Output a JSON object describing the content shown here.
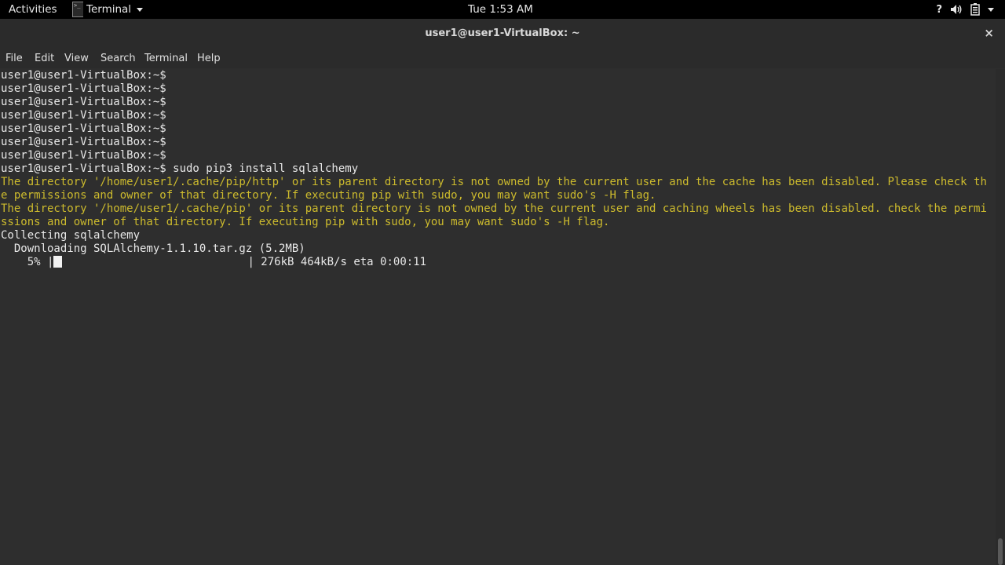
{
  "topbar": {
    "activities": "Activities",
    "app_name": "Terminal",
    "clock": "Tue  1:53 AM",
    "help_glyph": "?",
    "status_icons": [
      "help-icon",
      "speaker-icon",
      "battery-icon",
      "chevron-down-icon"
    ]
  },
  "window": {
    "title": "user1@user1-VirtualBox: ~",
    "close_glyph": "×"
  },
  "menu": [
    "File",
    "Edit",
    "View",
    "Search",
    "Terminal",
    "Help"
  ],
  "terminal": {
    "lines": [
      "user1@user1-VirtualBox:~$",
      "user1@user1-VirtualBox:~$",
      "user1@user1-VirtualBox:~$",
      "user1@user1-VirtualBox:~$",
      "user1@user1-VirtualBox:~$",
      "user1@user1-VirtualBox:~$",
      "user1@user1-VirtualBox:~$",
      "user1@user1-VirtualBox:~$ sudo pip3 install sqlalchemy",
      "The directory '/home/user1/.cache/pip/http' or its parent directory is not owned by the current user and the cache has been disabled. Please check th",
      "e permissions and owner of that directory. If executing pip with sudo, you may want sudo's -H flag.",
      "The directory '/home/user1/.cache/pip' or its parent directory is not owned by the current user and caching wheels has been disabled. check the permi",
      "ssions and owner of that directory. If executing pip with sudo, you may want sudo's -H flag.",
      "Collecting sqlalchemy",
      "  Downloading SQLAlchemy-1.1.10.tar.gz (5.2MB)"
    ],
    "progress": {
      "percent_label": "    5%",
      "progress_fraction": 0.05,
      "stats": "| 276kB 464kB/s eta 0:00:11"
    }
  },
  "colors": {
    "terminal_bg": "#2e2e2e",
    "warning_text": "#cdbb2d",
    "normal_text": "#e8e8e8"
  }
}
